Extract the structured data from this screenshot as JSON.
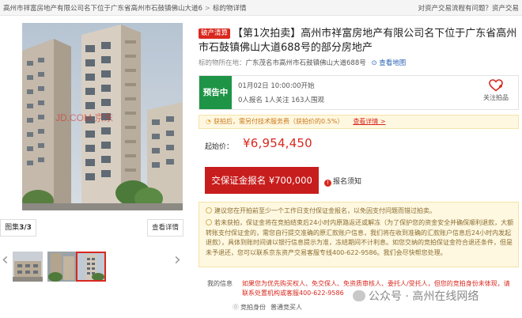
{
  "header": {
    "breadcrumb": [
      "高州市祥富房地产有限公司名下位于广东省高州市石鼓镇佛山大道6",
      "标的物详情"
    ],
    "help_link": "对资产交易流程有问题？资产交易"
  },
  "gallery": {
    "album_label": "图集",
    "album_count": "3/3",
    "view_detail": "查看详情",
    "prev_arrow": "‹",
    "next_arrow": "›",
    "photo_watermark": "JD.COM 京东"
  },
  "auction": {
    "bankrupt_badge": "破产清算",
    "title": "【第1次拍卖】高州市祥富房地产有限公司名下位于广东省高州市石鼓镇佛山大道688号的部分房地产",
    "location_label": "标的物所在地：",
    "location": "广东茂名市高州市石鼓镇佛山大道688号",
    "map_link": "查看地图"
  },
  "status": {
    "badge": "预告中",
    "start_time": "01月02日 10:00:00开始",
    "stats": "0人报名  1人关注  163人围观",
    "follow_label": "关注拍品"
  },
  "fee_notice": {
    "text": "获拍后，需另付技术服务费（获拍价的0.5%）",
    "link": "查看详情 >"
  },
  "price": {
    "label": "起始价：",
    "value": "¥6,954,450"
  },
  "bid": {
    "button": "交保证金报名 ¥700,000",
    "notice": "报名须知"
  },
  "notices": {
    "line1": "建议您在开拍前至少一个工作日支付保证金报名，以免因支付问题而错过拍卖。",
    "line2": "若未获拍，保证金将在竞拍结束后24小时内原路返还或解冻（为了保护您的资金安全并确保顺利退款，大额转账支付保证金的，需您自行提交准确的原汇款账户信息，我们将在收到准确的汇款账户信息后24小时内发起退款），具体到账时间请以银行信息提示为准，冻结期间不计利息。如您交纳的竞拍保证金符合退还条件，但是未予退还，您可以联系京东资产交易客服专线400-622-9586。我们会尽快帮您处理。"
  },
  "my_info": {
    "label": "我的信息",
    "text": "如果您为优先购买权人、免交保人、免资质审核人、委托人/受托人，但您的竞拍身份未体现，请联系处置机构或客服400-622-9586",
    "identity_label": "竞拍身份",
    "identity_value": "普通竞买人"
  },
  "watermark": {
    "text": "公众号 · 高州在线网络"
  }
}
